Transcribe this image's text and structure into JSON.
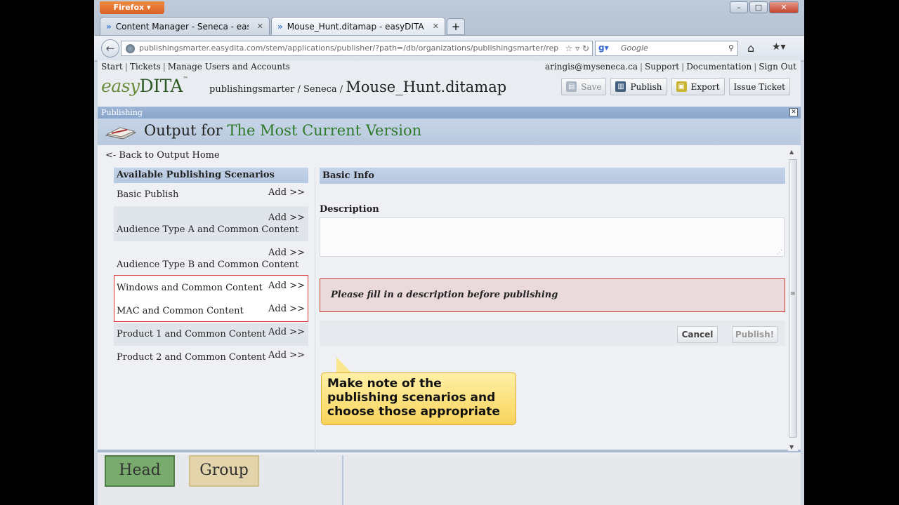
{
  "browser": {
    "app_button": "Firefox",
    "tabs": [
      {
        "title": "Content Manager - Seneca - easyDITA"
      },
      {
        "title": "Mouse_Hunt.ditamap - easyDITA Pu..."
      }
    ],
    "url": "publishingsmarter.easydita.com/stem/applications/publisher/?path=/db/organizations/publishingsmarter/rep",
    "search_placeholder": "Google"
  },
  "topnav": {
    "left": [
      "Start",
      "Tickets",
      "Manage Users and Accounts"
    ],
    "right": [
      "aringis@myseneca.ca",
      "Support",
      "Documentation",
      "Sign Out"
    ]
  },
  "header": {
    "logo_easy": "easy",
    "logo_dita": "DITA",
    "logo_tm": "™",
    "breadcrumb_path": "publishingsmarter / Seneca /",
    "document": "Mouse_Hunt.ditamap"
  },
  "toolbar": {
    "save": "Save",
    "publish": "Publish",
    "export": "Export",
    "issue_ticket": "Issue Ticket"
  },
  "panel": {
    "title": "Publishing",
    "output_prefix": "Output for",
    "output_version": "The Most Current Version",
    "back_link": "<- Back to Output Home"
  },
  "scenarios": {
    "header": "Available Publishing Scenarios",
    "add_label": "Add >>",
    "items": [
      {
        "name": "Basic Publish"
      },
      {
        "name": "Audience Type A and Common Content"
      },
      {
        "name": "Audience Type B and Common Content"
      },
      {
        "name": "Windows and Common Content"
      },
      {
        "name": "MAC and Common Content"
      },
      {
        "name": "Product 1 and Common Content"
      },
      {
        "name": "Product 2 and Common Content"
      }
    ]
  },
  "basic_info": {
    "header": "Basic Info",
    "description_label": "Description",
    "description_value": "",
    "warning": "Please fill in a description before publishing",
    "cancel": "Cancel",
    "publish": "Publish!"
  },
  "callout": {
    "text": "Make note of the publishing scenarios and choose those appropriate"
  },
  "background_blocks": {
    "head": "Head",
    "group": "Group"
  },
  "colors": {
    "version_green": "#2e7a2a",
    "warning_border": "#c9362f",
    "highlight_red": "#dd3333",
    "callout_yellow": "#f8d35b"
  }
}
